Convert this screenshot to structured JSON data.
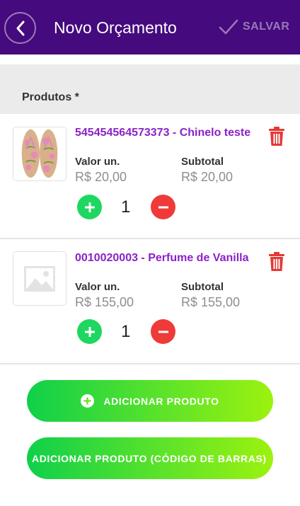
{
  "header": {
    "title": "Novo Orçamento",
    "save_label": "SALVAR",
    "back_icon": "chevron-left-icon",
    "save_icon": "checkmark-icon"
  },
  "products_section": {
    "title": "Produtos *"
  },
  "products": [
    {
      "name": "545454564573373 - Chinelo teste",
      "unit_label": "Valor un.",
      "unit_value": "R$ 20,00",
      "subtotal_label": "Subtotal",
      "subtotal_value": "R$ 20,00",
      "quantity": "1",
      "image": "flip-flop-photo"
    },
    {
      "name": "0010020003 - Perfume de Vanilla",
      "unit_label": "Valor un.",
      "unit_value": "R$ 155,00",
      "subtotal_label": "Subtotal",
      "subtotal_value": "R$ 155,00",
      "quantity": "1",
      "image": "image-placeholder-icon"
    }
  ],
  "actions": {
    "add_product": "ADICIONAR PRODUTO",
    "add_product_barcode": "ADICIONAR PRODUTO (CÓDIGO DE BARRAS)"
  },
  "colors": {
    "header_bg": "#450a7e",
    "product_name": "#8a22c7",
    "plus": "#1ed760",
    "minus": "#ef3a3a",
    "trash": "#e53935",
    "button_gradient_start": "#0fd04a",
    "button_gradient_end": "#9cf20f"
  }
}
